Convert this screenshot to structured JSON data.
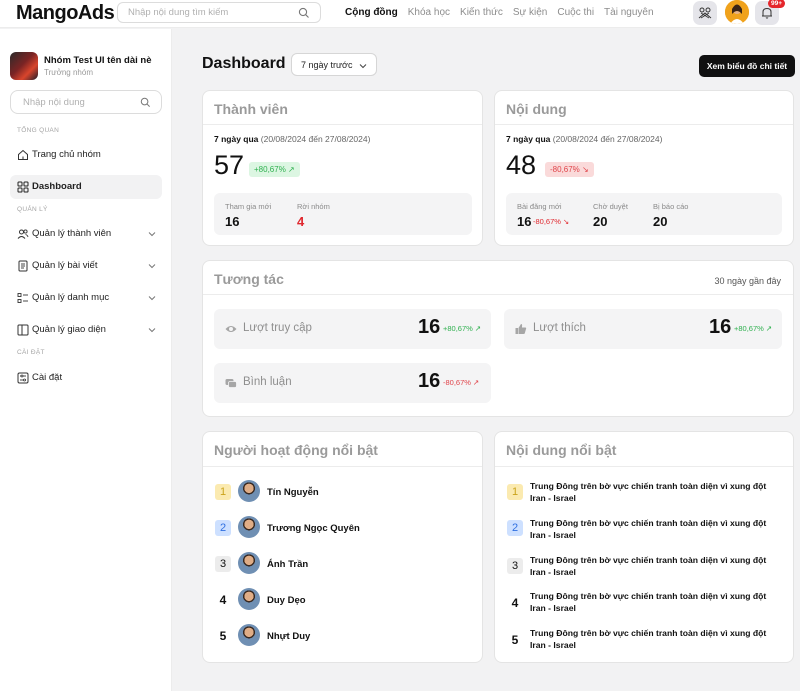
{
  "header": {
    "logo": "MangoAds",
    "search_placeholder": "Nhập nội dung tìm kiếm",
    "nav": [
      "Cộng đồng",
      "Khóa học",
      "Kiến thức",
      "Sự kiện",
      "Cuộc thi",
      "Tài nguyên"
    ],
    "notification_badge": "99+"
  },
  "sidebar": {
    "group_name": "Nhóm Test UI tên dài nè",
    "group_role": "Trưởng nhóm",
    "search_placeholder": "Nhập nội dung",
    "section_overview": "TỔNG QUAN",
    "section_manage": "QUẢN LÝ",
    "section_settings": "CÀI ĐẶT",
    "items": [
      {
        "label": "Trang chủ nhóm",
        "icon": "home-icon"
      },
      {
        "label": "Dashboard",
        "icon": "grid-icon",
        "active": true
      },
      {
        "label": "Quản lý thành viên",
        "icon": "users-icon"
      },
      {
        "label": "Quản lý bài viết",
        "icon": "post-icon"
      },
      {
        "label": "Quản lý danh mục",
        "icon": "category-icon"
      },
      {
        "label": "Quản lý giao diện",
        "icon": "layout-icon"
      },
      {
        "label": "Cài đặt",
        "icon": "settings-icon"
      }
    ]
  },
  "main": {
    "title": "Dashboard",
    "range": "7 ngày trước",
    "detail_button": "Xem biểu đồ chi tiết",
    "members": {
      "title": "Thành viên",
      "period_label": "7 ngày qua",
      "period_range": "(20/08/2024 đến 27/08/2024)",
      "total": "57",
      "change": "+80,67% ↗",
      "joined_label": "Tham gia mới",
      "joined_value": "16",
      "left_label": "Rời nhóm",
      "left_value": "4"
    },
    "content": {
      "title": "Nội dung",
      "period_label": "7 ngày qua",
      "period_range": "(20/08/2024 đến 27/08/2024)",
      "total": "48",
      "change": "-80,67% ↘",
      "new_posts_label": "Bài đăng mới",
      "new_posts_value": "16",
      "new_posts_change": "-80,67% ↘",
      "pending_label": "Chờ duyệt",
      "pending_value": "20",
      "reported_label": "Bị báo cáo",
      "reported_value": "20"
    },
    "interaction": {
      "title": "Tương tác",
      "period": "30 ngày gần đây",
      "views_label": "Lượt truy cập",
      "views_value": "16",
      "views_change": "+80,67% ↗",
      "likes_label": "Lượt thích",
      "likes_value": "16",
      "likes_change": "+80,67% ↗",
      "comments_label": "Bình luận",
      "comments_value": "16",
      "comments_change": "-80,67% ↗"
    },
    "top_users": {
      "title": "Người hoạt động nổi bật",
      "users": [
        {
          "rank": "1",
          "name": "Tín Nguyễn"
        },
        {
          "rank": "2",
          "name": "Trương Ngọc Quyên"
        },
        {
          "rank": "3",
          "name": "Ánh Trần"
        },
        {
          "rank": "4",
          "name": "Duy Dẹo"
        },
        {
          "rank": "5",
          "name": "Nhựt Duy"
        }
      ]
    },
    "top_content": {
      "title": "Nội dung nổi bật",
      "posts": [
        {
          "rank": "1",
          "text": "Trung Đông trên bờ vực chiến tranh toàn diện vì xung đột Iran - Israel"
        },
        {
          "rank": "2",
          "text": "Trung Đông trên bờ vực chiến tranh toàn diện vì xung đột Iran - Israel"
        },
        {
          "rank": "3",
          "text": "Trung Đông trên bờ vực chiến tranh toàn diện vì xung đột Iran - Israel"
        },
        {
          "rank": "4",
          "text": "Trung Đông trên bờ vực chiến tranh toàn diện vì xung đột Iran - Israel"
        },
        {
          "rank": "5",
          "text": "Trung Đông trên bờ vực chiến tranh toàn diện vì xung đột Iran - Israel"
        }
      ]
    }
  }
}
